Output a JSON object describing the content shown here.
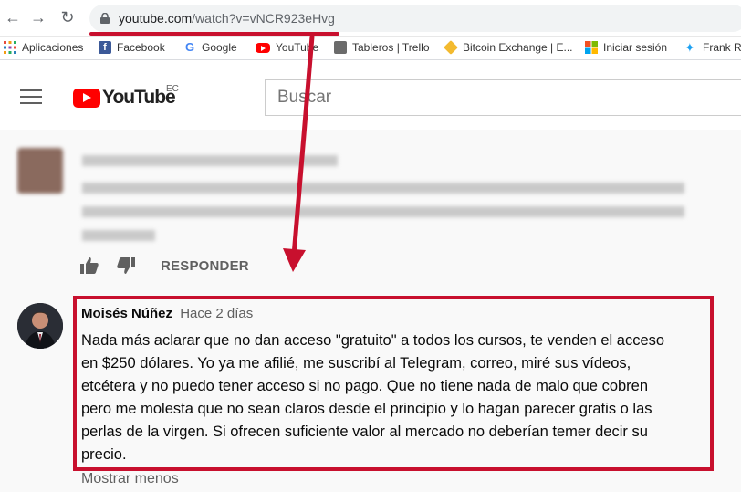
{
  "browser": {
    "url_host": "youtube.com",
    "url_path": "/watch?v=vNCR923eHvg"
  },
  "bookmarks": [
    {
      "label": "Aplicaciones",
      "icon": "apps-grid-icon",
      "color": "#5f6368"
    },
    {
      "label": "Facebook",
      "icon": "facebook-icon",
      "color": "#3b5998"
    },
    {
      "label": "Google",
      "icon": "google-icon",
      "color": "#4285f4"
    },
    {
      "label": "YouTube",
      "icon": "youtube-icon",
      "color": "#ff0000"
    },
    {
      "label": "Tableros | Trello",
      "icon": "trello-icon",
      "color": "#6b6b6b"
    },
    {
      "label": "Bitcoin Exchange | E...",
      "icon": "bitcoin-exchange-icon",
      "color": "#f3ba2f"
    },
    {
      "label": "Iniciar sesión",
      "icon": "microsoft-icon",
      "color": "#f25022"
    },
    {
      "label": "Frank R",
      "icon": "twitter-icon",
      "color": "#1da1f2"
    }
  ],
  "youtube": {
    "logo_text": "YouTube",
    "country": "EC",
    "search_placeholder": "Buscar"
  },
  "blurred_comment": {
    "reply_label": "RESPONDER"
  },
  "comment": {
    "author": "Moisés Núñez",
    "time": "Hace 2 días",
    "lines": [
      "Nada más aclarar que no dan acceso \"gratuito\" a todos los cursos, te venden el acceso",
      "en  $250 dólares. Yo ya me afilié, me suscribí al Telegram, correo, miré sus vídeos,",
      "etcétera y no puedo tener acceso si no pago. Que no tiene nada de malo que cobren",
      "pero me molesta que no sean claros desde el principio y lo hagan parecer gratis o las",
      "perlas de la virgen. Si ofrecen suficiente valor al mercado no deberían temer decir su",
      "precio."
    ],
    "show_less": "Mostrar menos"
  },
  "colors": {
    "annotation_red": "#c8102e",
    "youtube_red": "#ff0000"
  }
}
